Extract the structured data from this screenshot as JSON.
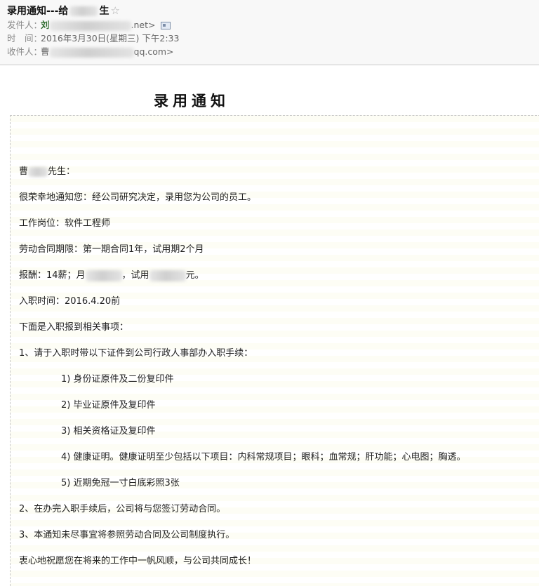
{
  "email": {
    "subject": "录用通知---给",
    "subject_tail": "生",
    "star_icon": "star-outline-icon",
    "sender_label": "发件人：",
    "sender_name": "刘",
    "sender_email_tail": ".net>",
    "time_label": "时　间：",
    "time_value": "2016年3月30日(星期三) 下午2:33",
    "recipient_label": "收件人：",
    "recipient_prefix": "曹",
    "recipient_email_tail": "qq.com>"
  },
  "letter": {
    "title": "录用通知",
    "greeting_prefix": "曹",
    "greeting_suffix": "先生：",
    "intro": "很荣幸地通知您：经公司研究决定，录用您为公司的员工。",
    "position": "工作岗位：软件工程师",
    "contract": "劳动合同期限：第一期合同1年，试用期2个月",
    "pay_prefix": "报酬：14薪；月",
    "pay_middle": "，试用",
    "pay_suffix": "元。",
    "start_date": "入职时间：2016.4.20前",
    "matters_heading": "下面是入职报到相关事项：",
    "item1": "1、请于入职时带以下证件到公司行政人事部办入职手续：",
    "docs": [
      "1)  身份证原件及二份复印件",
      "2)  毕业证原件及复印件",
      "3)  相关资格证及复印件",
      "4)  健康证明。健康证明至少包括以下项目：内科常规项目；眼科；血常规；肝功能；心电图；胸透。",
      "5)  近期免冠一寸白底彩照3张"
    ],
    "item2": "2、在办完入职手续后，公司将与您签订劳动合同。",
    "item3": "3、本通知未尽事宜将参照劳动合同及公司制度执行。",
    "closing": "衷心地祝愿您在将来的工作中一帆风顺，与公司共同成长！"
  }
}
